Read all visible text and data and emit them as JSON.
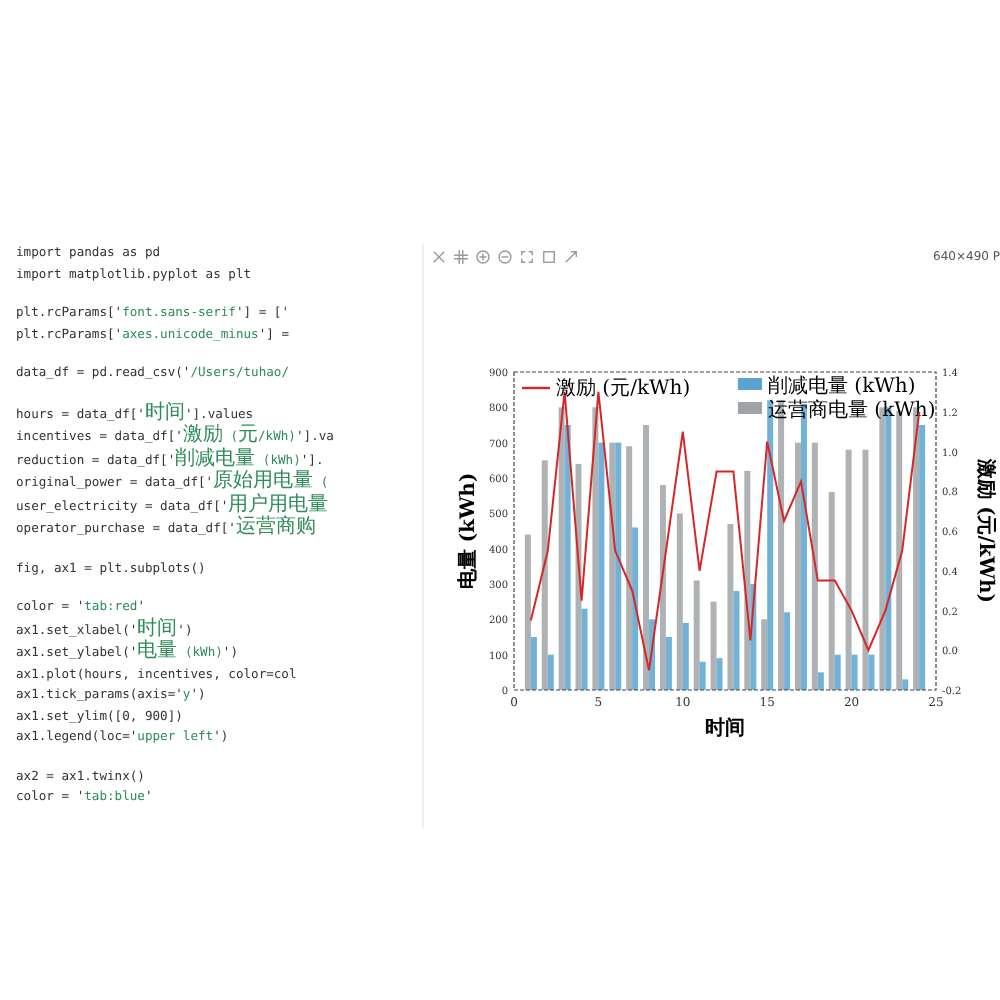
{
  "editor": {
    "blocks": [
      [
        "import pandas as pd",
        "import matplotlib.pyplot as plt"
      ],
      [
        "plt.rcParams['font.sans-serif'] = ['",
        "plt.rcParams['axes.unicode_minus'] ="
      ],
      [
        "data_df = pd.read_csv('/Users/tuhao/"
      ],
      [
        "hours = data_df['时间'].values",
        "incentives = data_df['激励 (元/kWh)'].va",
        "reduction = data_df['削减电量 (kWh)'].",
        "original_power = data_df['原始用电量 (",
        "user_electricity = data_df['用户用电量",
        "operator_purchase = data_df['运营商购"
      ],
      [
        "fig, ax1 = plt.subplots()"
      ],
      [
        "color = 'tab:red'",
        "ax1.set_xlabel('时间')",
        "ax1.set_ylabel('电量 (kWh)')",
        "ax1.plot(hours, incentives, color=col",
        "ax1.tick_params(axis='y')",
        "ax1.set_ylim([0, 900])",
        "ax1.legend(loc='upper left')"
      ],
      [
        "ax2 = ax1.twinx()",
        "color = 'tab:blue'"
      ]
    ]
  },
  "viewer": {
    "size": "640×490 P"
  },
  "bar_plot": {
    "chart_data": {
      "type": "bar",
      "xlabel": "时间",
      "ylabel": "电量 (kWh)",
      "legend": "upper right",
      "x": [
        1,
        2,
        3,
        4,
        5,
        6,
        7,
        8,
        9,
        10,
        11,
        12,
        13,
        14,
        15,
        16,
        17,
        18,
        19,
        20,
        21,
        22,
        23,
        24
      ],
      "xlim": [
        0,
        25
      ],
      "ylim": [
        0,
        900
      ],
      "xticks": [
        0,
        5,
        10,
        15,
        20,
        25
      ],
      "yticks": [
        0,
        100,
        200,
        300,
        400,
        500,
        600,
        700,
        800,
        900
      ],
      "series": [
        {
          "name": "运营商电量 (kWh)",
          "color": "#a0a4a8",
          "values": [
            440,
            650,
            800,
            640,
            800,
            700,
            690,
            750,
            580,
            500,
            310,
            250,
            470,
            620,
            200,
            820,
            700,
            700,
            560,
            680,
            680,
            800,
            790,
            800
          ]
        },
        {
          "name": "削减电量 (kWh)",
          "color": "#5aa5d0",
          "values": [
            150,
            100,
            750,
            230,
            700,
            700,
            460,
            200,
            150,
            190,
            80,
            90,
            280,
            300,
            820,
            220,
            810,
            50,
            100,
            100,
            100,
            800,
            30,
            750
          ]
        }
      ]
    }
  },
  "line_plot": {
    "chart_data": {
      "type": "line",
      "ylabel": "激励 (元/kWh)",
      "legend": "upper left",
      "x": [
        1,
        2,
        3,
        4,
        5,
        6,
        7,
        8,
        9,
        10,
        11,
        12,
        13,
        14,
        15,
        16,
        17,
        18,
        19,
        20,
        21,
        22,
        23,
        24
      ],
      "xlim": [
        0,
        25
      ],
      "ylim": [
        -0.2,
        1.4
      ],
      "yticks": [
        {
          "value": -0.2,
          "label": "-0.2"
        },
        {
          "value": 0,
          "label": "0.0"
        },
        {
          "value": 0.2,
          "label": "0.2"
        },
        {
          "value": 0.4,
          "label": "0.4"
        },
        {
          "value": 0.6,
          "label": "0.6"
        },
        {
          "value": 0.8,
          "label": "0.8"
        },
        {
          "value": 1,
          "label": "1.0"
        },
        {
          "value": 1.2,
          "label": "1.2"
        },
        {
          "value": 1.4,
          "label": "1.4"
        }
      ],
      "series": [
        {
          "name": "激励 (元/kWh)",
          "color": "#d62728",
          "values": [
            0.15,
            0.5,
            1.3,
            0.25,
            1.3,
            0.5,
            0.3,
            -0.1,
            0.5,
            1.1,
            0.4,
            0.9,
            0.9,
            0.05,
            1.05,
            0.65,
            0.85,
            0.35,
            0.35,
            0.2,
            0.0,
            0.2,
            0.5,
            1.2
          ]
        }
      ]
    }
  }
}
